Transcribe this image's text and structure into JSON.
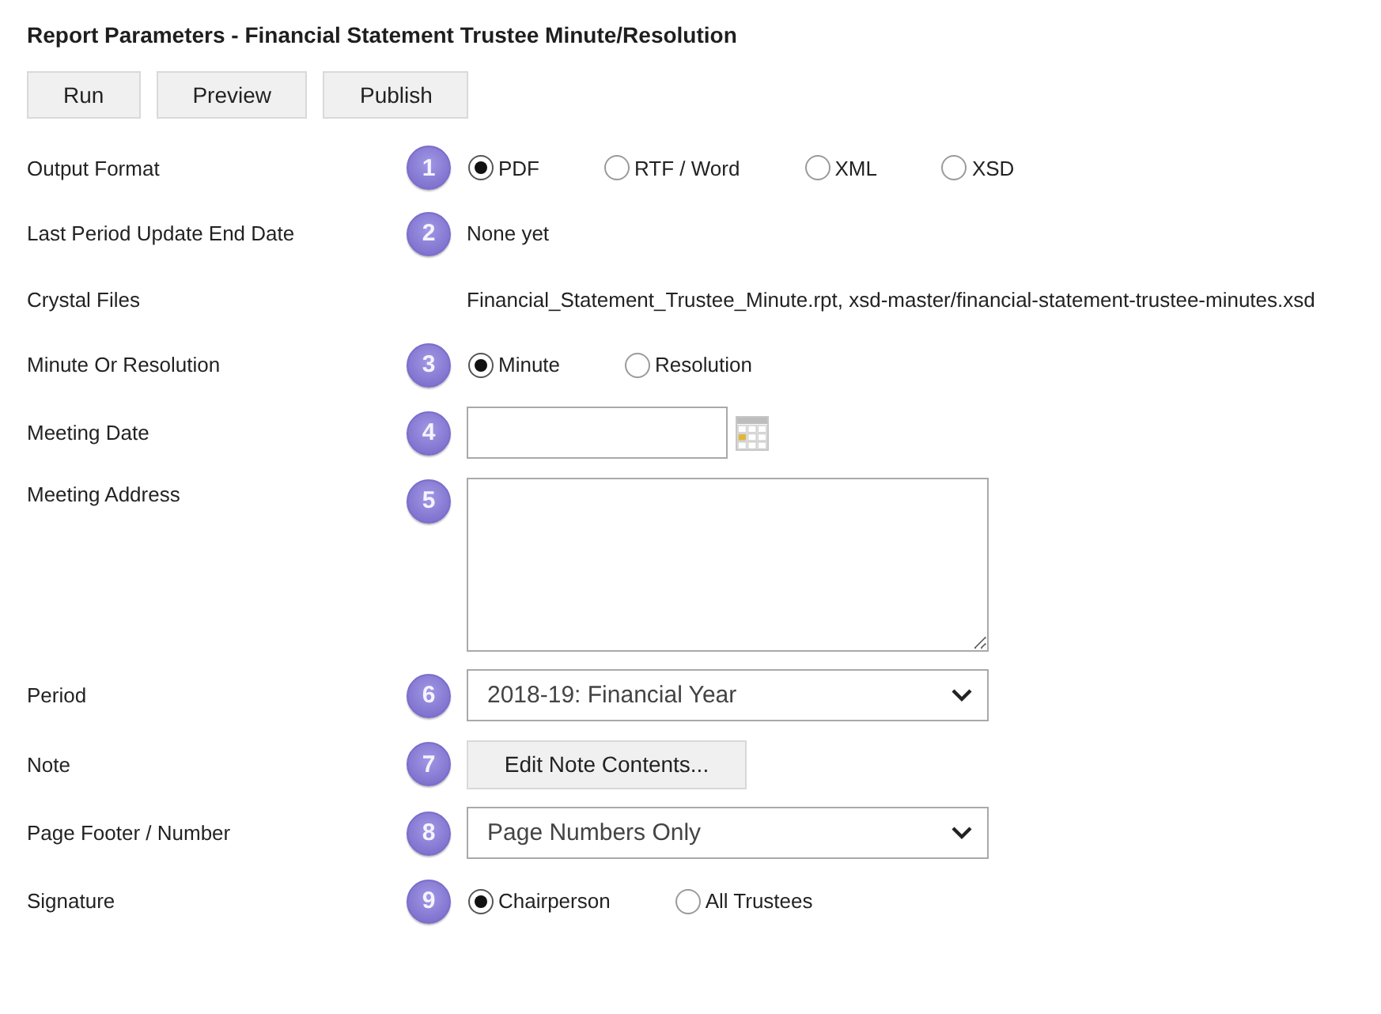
{
  "title": "Report Parameters - Financial Statement Trustee Minute/Resolution",
  "toolbar": {
    "buttons": [
      "Run",
      "Preview",
      "Publish"
    ]
  },
  "fields": [
    {
      "kind": "radio",
      "label": "Output Format",
      "marker": "1",
      "options": [
        {
          "label": "PDF",
          "selected": true
        },
        {
          "label": "RTF / Word",
          "selected": false
        },
        {
          "label": "XML",
          "selected": false
        },
        {
          "label": "XSD",
          "selected": false
        }
      ]
    },
    {
      "kind": "text",
      "label": "Last Period Update End Date",
      "marker": "2",
      "value": "None yet"
    },
    {
      "kind": "text",
      "label": "Crystal Files",
      "value": "Financial_Statement_Trustee_Minute.rpt, xsd-master/financial-statement-trustee-minutes.xsd"
    },
    {
      "kind": "radio",
      "label": "Minute Or Resolution",
      "marker": "3",
      "options": [
        {
          "label": "Minute",
          "selected": true
        },
        {
          "label": "Resolution",
          "selected": false
        }
      ]
    },
    {
      "kind": "date",
      "label": "Meeting Date",
      "marker": "4"
    },
    {
      "kind": "textarea",
      "label": "Meeting Address",
      "marker": "5"
    },
    {
      "kind": "select",
      "label": "Period",
      "marker": "6",
      "value": "2018-19: Financial Year"
    },
    {
      "kind": "button",
      "label": "Note",
      "marker": "7",
      "button": "Edit Note Contents..."
    },
    {
      "kind": "select",
      "label": "Page Footer / Number",
      "marker": "8",
      "value": "Page Numbers Only"
    },
    {
      "kind": "radio",
      "label": "Signature",
      "marker": "9",
      "options": [
        {
          "label": "Chairperson",
          "selected": true
        },
        {
          "label": "All Trustees",
          "selected": false
        }
      ]
    }
  ]
}
